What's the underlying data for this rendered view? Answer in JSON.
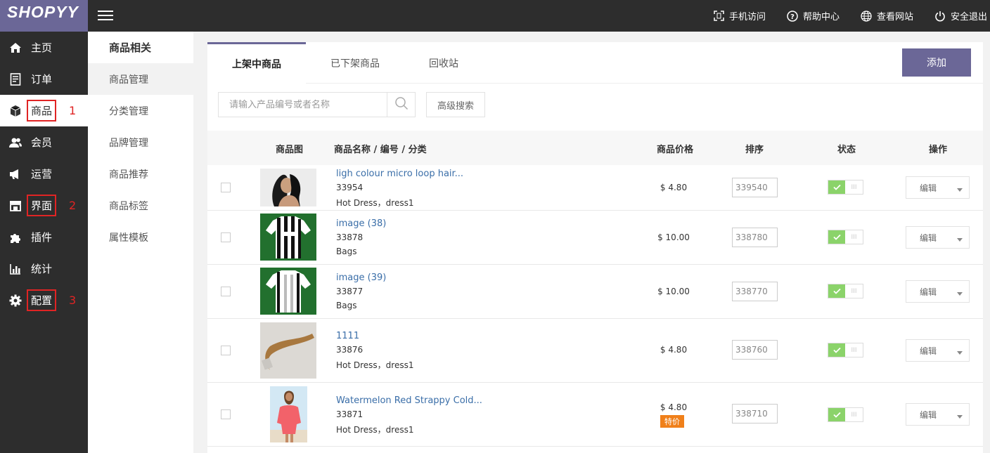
{
  "app": {
    "logo": "SHOPYY"
  },
  "topbar": {
    "links": [
      {
        "label": "手机访问",
        "icon": "mobile-scan-icon"
      },
      {
        "label": "帮助中心",
        "icon": "help-circle-icon"
      },
      {
        "label": "查看网站",
        "icon": "globe-icon"
      },
      {
        "label": "安全退出",
        "icon": "power-icon"
      }
    ]
  },
  "sidebar": {
    "items": [
      {
        "label": "主页",
        "icon": "home-icon",
        "num": ""
      },
      {
        "label": "订单",
        "icon": "order-doc-icon",
        "num": ""
      },
      {
        "label": "商品",
        "icon": "box-icon",
        "num": "1"
      },
      {
        "label": "会员",
        "icon": "users-icon",
        "num": ""
      },
      {
        "label": "运营",
        "icon": "megaphone-icon",
        "num": ""
      },
      {
        "label": "界面",
        "icon": "store-icon",
        "num": "2"
      },
      {
        "label": "插件",
        "icon": "puzzle-icon",
        "num": ""
      },
      {
        "label": "统计",
        "icon": "bar-chart-icon",
        "num": ""
      },
      {
        "label": "配置",
        "icon": "gear-icon",
        "num": "3"
      }
    ]
  },
  "subnav": {
    "title": "商品相关",
    "items": [
      "商品管理",
      "分类管理",
      "品牌管理",
      "商品推荐",
      "商品标签",
      "属性模板"
    ]
  },
  "tabs": [
    "上架中商品",
    "已下架商品",
    "回收站"
  ],
  "add_label": "添加",
  "search": {
    "placeholder": "请输入产品编号或者名称",
    "advanced_label": "高级搜索"
  },
  "table": {
    "headers": [
      "商品图",
      "商品名称 / 编号 / 分类",
      "商品价格",
      "排序",
      "状态",
      "操作"
    ],
    "edit_label": "编辑",
    "toggle_off_text": "III",
    "rows": [
      {
        "name": "ligh colour micro loop hair...",
        "no": "33954",
        "cat": "Hot Dress，dress1",
        "price": "$ 4.80",
        "badge": "",
        "sort": "339540",
        "thumb": "curly-hair-model"
      },
      {
        "name": "image (38)",
        "no": "33878",
        "cat": "Bags",
        "price": "$ 10.00",
        "badge": "",
        "sort": "338780",
        "thumb": "striped-jersey"
      },
      {
        "name": "image (39)",
        "no": "33877",
        "cat": "Bags",
        "price": "$ 10.00",
        "badge": "",
        "sort": "338770",
        "thumb": "striped-jersey-back"
      },
      {
        "name": "1111",
        "no": "33876",
        "cat": "Hot Dress，dress1",
        "price": "$ 4.80",
        "badge": "",
        "sort": "338760",
        "thumb": "hair-extension"
      },
      {
        "name": "Watermelon Red Strappy Cold...",
        "no": "33871",
        "cat": "Hot Dress，dress1",
        "price": "$ 4.80",
        "badge": "特价",
        "sort": "338710",
        "thumb": "red-top-model"
      }
    ]
  }
}
